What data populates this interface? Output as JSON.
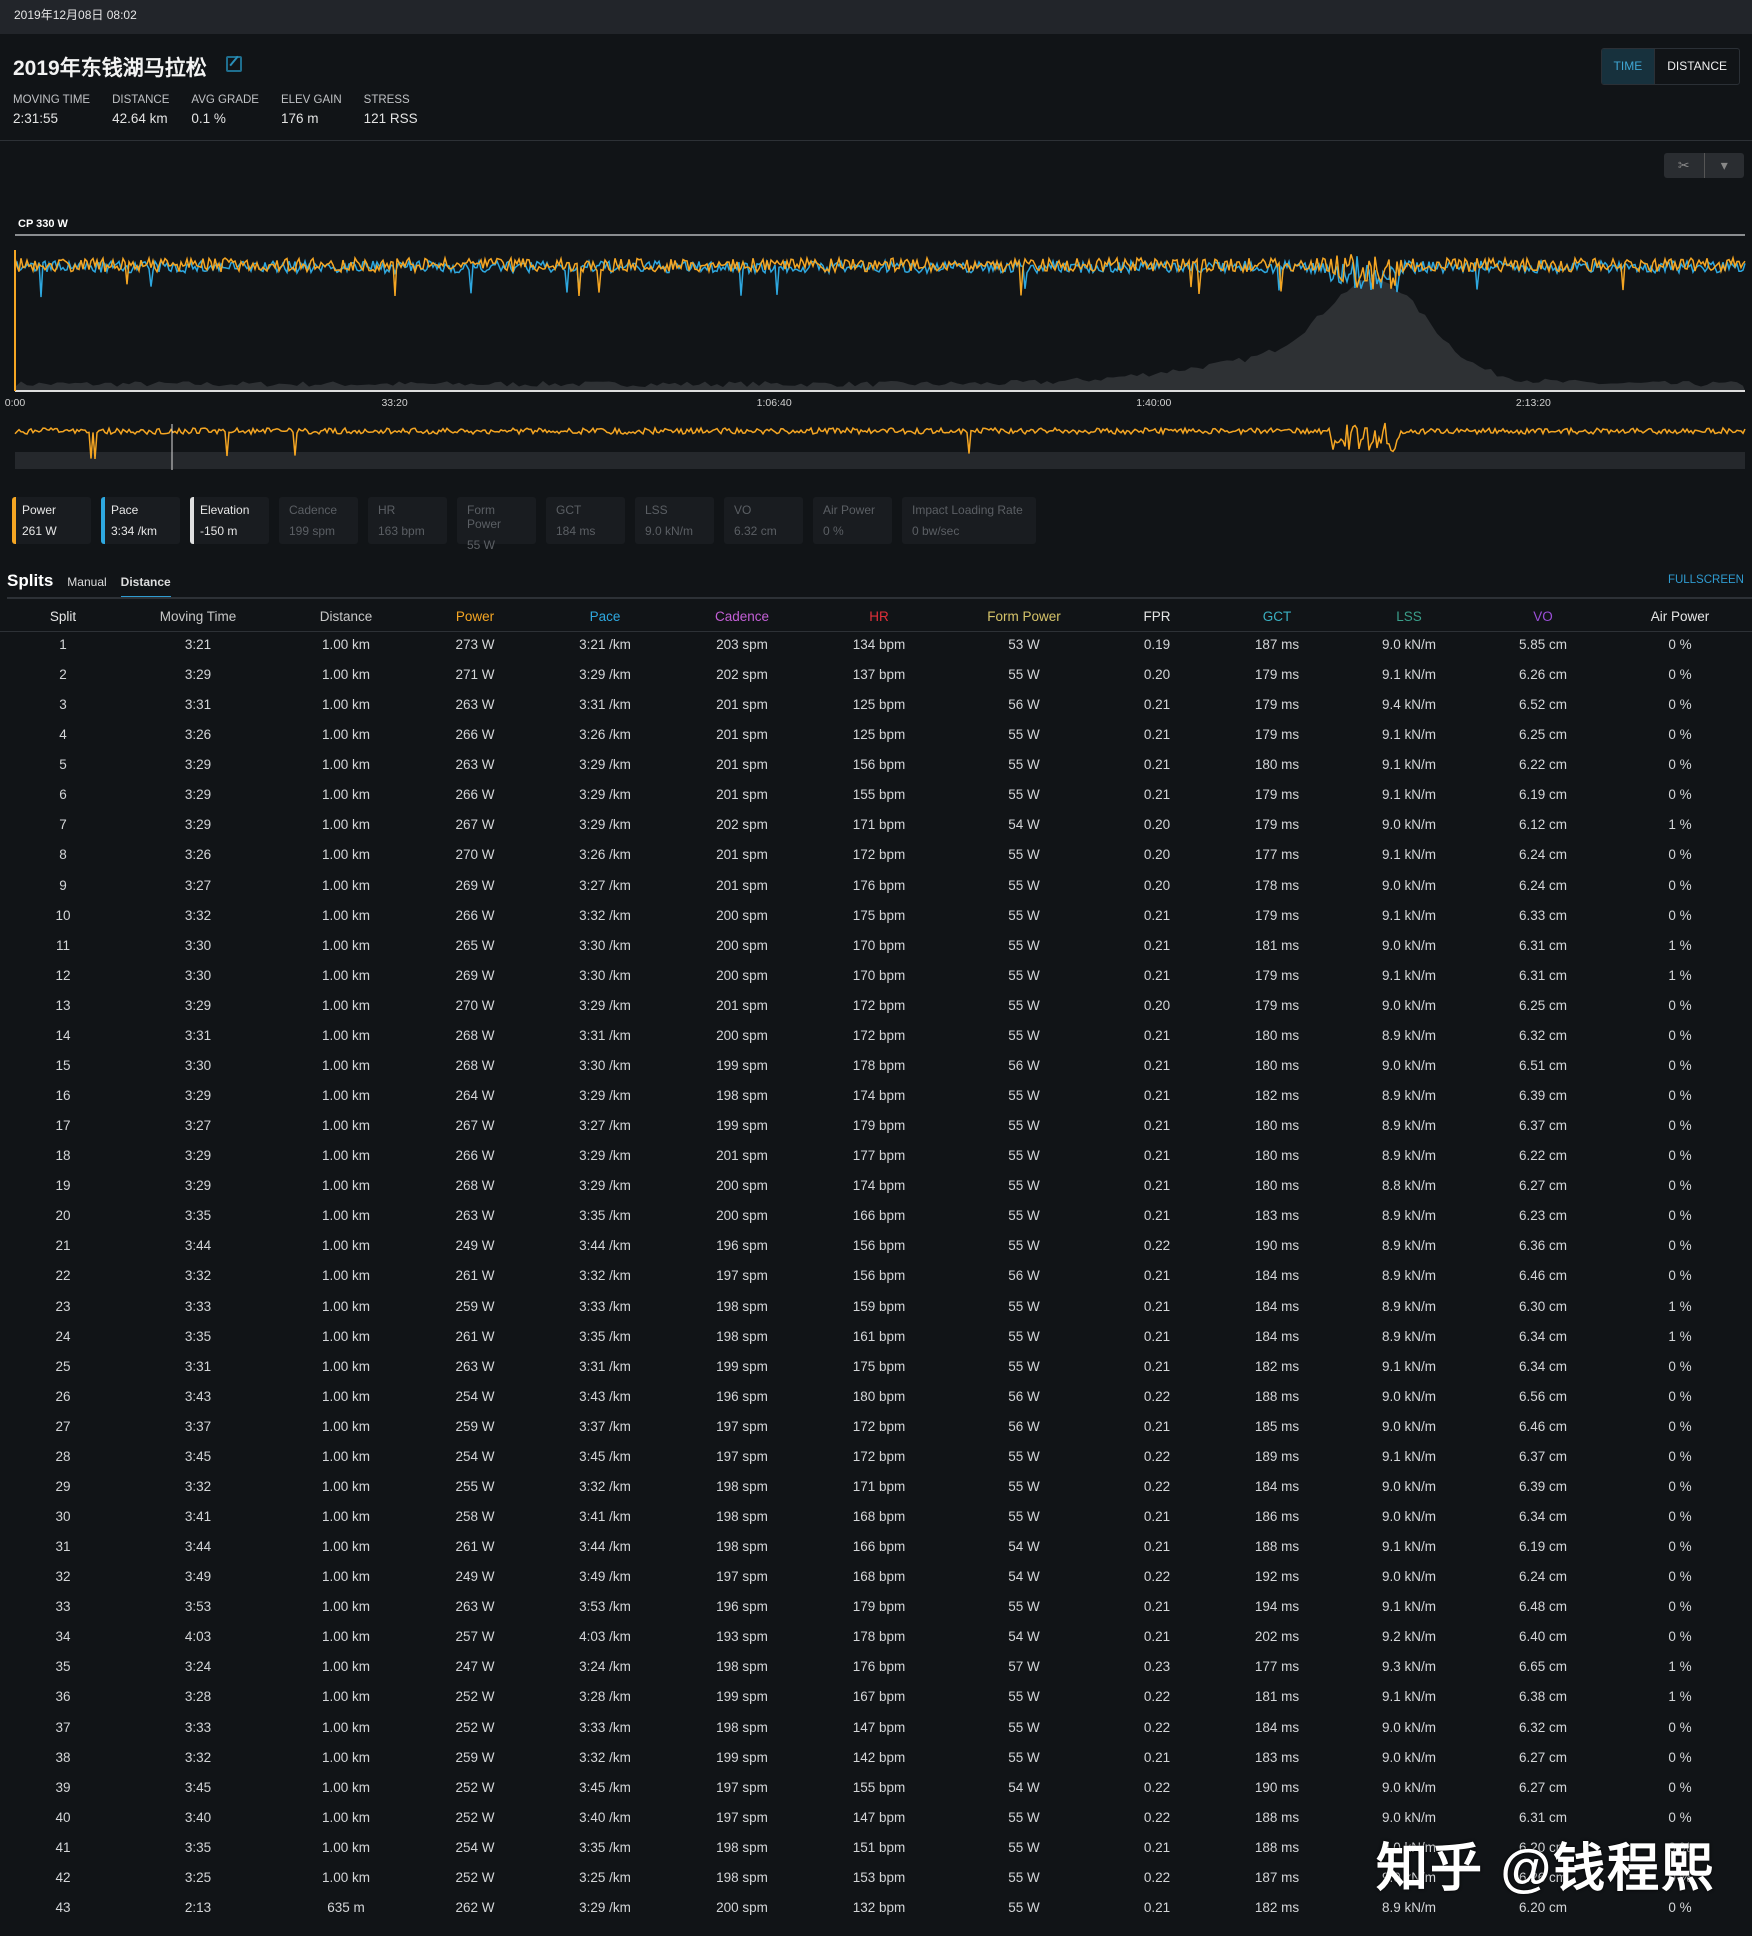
{
  "topbar": {
    "datetime": "2019年12月08日 08:02"
  },
  "header": {
    "title": "2019年东钱湖马拉松",
    "edit_icon": "external-edit-icon",
    "stats": [
      {
        "label": "MOVING TIME",
        "value": "2:31:55"
      },
      {
        "label": "DISTANCE",
        "value": "42.64 km"
      },
      {
        "label": "AVG GRADE",
        "value": "0.1 %"
      },
      {
        "label": "ELEV GAIN",
        "value": "176 m"
      },
      {
        "label": "STRESS",
        "value": "121 RSS"
      }
    ],
    "toggle": {
      "time": "TIME",
      "distance": "DISTANCE",
      "selected": "TIME"
    }
  },
  "chart": {
    "cp_label": "CP 330 W",
    "ticks": [
      "0:00",
      "33:20",
      "1:06:40",
      "1:40:00",
      "2:13:20"
    ],
    "colors": {
      "power": "#f5a623",
      "pace": "#2ea8e0",
      "elevation": "#3a3d41"
    },
    "tools": {
      "scissors_icon": "scissors-icon",
      "dropdown_icon": "caret-down-icon"
    }
  },
  "metrics": [
    {
      "name": "Power",
      "value": "261 W",
      "active": true,
      "color": "#f5a623"
    },
    {
      "name": "Pace",
      "value": "3:34 /km",
      "active": true,
      "color": "#2ea8e0"
    },
    {
      "name": "Elevation",
      "value": "-150 m",
      "active": true,
      "color": "#e0e0e0"
    },
    {
      "name": "Cadence",
      "value": "199 spm",
      "active": false
    },
    {
      "name": "HR",
      "value": "163 bpm",
      "active": false
    },
    {
      "name": "Form Power",
      "value": "55 W",
      "active": false
    },
    {
      "name": "GCT",
      "value": "184 ms",
      "active": false
    },
    {
      "name": "LSS",
      "value": "9.0 kN/m",
      "active": false
    },
    {
      "name": "VO",
      "value": "6.32 cm",
      "active": false
    },
    {
      "name": "Air Power",
      "value": "0 %",
      "active": false
    },
    {
      "name": "Impact Loading Rate",
      "value": "0 bw/sec",
      "active": false
    }
  ],
  "splits": {
    "title": "Splits",
    "tabs": [
      "Manual",
      "Distance"
    ],
    "active_tab": "Distance",
    "fullscreen": "FULLSCREEN",
    "columns": [
      {
        "label": "Split",
        "color": "#e6e6e6"
      },
      {
        "label": "Moving Time",
        "color": "#c8c8c8"
      },
      {
        "label": "Distance",
        "color": "#c8c8c8"
      },
      {
        "label": "Power",
        "color": "#f5a623"
      },
      {
        "label": "Pace",
        "color": "#2ea8e0"
      },
      {
        "label": "Cadence",
        "color": "#c35fd6"
      },
      {
        "label": "HR",
        "color": "#e0303a"
      },
      {
        "label": "Form Power",
        "color": "#d6c46a"
      },
      {
        "label": "FPR",
        "color": "#e6e6e6"
      },
      {
        "label": "GCT",
        "color": "#3ab0c2"
      },
      {
        "label": "LSS",
        "color": "#3a9f8a"
      },
      {
        "label": "VO",
        "color": "#9b4fd8"
      },
      {
        "label": "Air Power",
        "color": "#e6e6e6"
      }
    ],
    "rows": [
      [
        "1",
        "3:21",
        "1.00 km",
        "273 W",
        "3:21 /km",
        "203 spm",
        "134 bpm",
        "53 W",
        "0.19",
        "187 ms",
        "9.0 kN/m",
        "5.85 cm",
        "0 %"
      ],
      [
        "2",
        "3:29",
        "1.00 km",
        "271 W",
        "3:29 /km",
        "202 spm",
        "137 bpm",
        "55 W",
        "0.20",
        "179 ms",
        "9.1 kN/m",
        "6.26 cm",
        "0 %"
      ],
      [
        "3",
        "3:31",
        "1.00 km",
        "263 W",
        "3:31 /km",
        "201 spm",
        "125 bpm",
        "56 W",
        "0.21",
        "179 ms",
        "9.4 kN/m",
        "6.52 cm",
        "0 %"
      ],
      [
        "4",
        "3:26",
        "1.00 km",
        "266 W",
        "3:26 /km",
        "201 spm",
        "125 bpm",
        "55 W",
        "0.21",
        "179 ms",
        "9.1 kN/m",
        "6.25 cm",
        "0 %"
      ],
      [
        "5",
        "3:29",
        "1.00 km",
        "263 W",
        "3:29 /km",
        "201 spm",
        "156 bpm",
        "55 W",
        "0.21",
        "180 ms",
        "9.1 kN/m",
        "6.22 cm",
        "0 %"
      ],
      [
        "6",
        "3:29",
        "1.00 km",
        "266 W",
        "3:29 /km",
        "201 spm",
        "155 bpm",
        "55 W",
        "0.21",
        "179 ms",
        "9.1 kN/m",
        "6.19 cm",
        "0 %"
      ],
      [
        "7",
        "3:29",
        "1.00 km",
        "267 W",
        "3:29 /km",
        "202 spm",
        "171 bpm",
        "54 W",
        "0.20",
        "179 ms",
        "9.0 kN/m",
        "6.12 cm",
        "1 %"
      ],
      [
        "8",
        "3:26",
        "1.00 km",
        "270 W",
        "3:26 /km",
        "201 spm",
        "172 bpm",
        "55 W",
        "0.20",
        "177 ms",
        "9.1 kN/m",
        "6.24 cm",
        "0 %"
      ],
      [
        "9",
        "3:27",
        "1.00 km",
        "269 W",
        "3:27 /km",
        "201 spm",
        "176 bpm",
        "55 W",
        "0.20",
        "178 ms",
        "9.0 kN/m",
        "6.24 cm",
        "0 %"
      ],
      [
        "10",
        "3:32",
        "1.00 km",
        "266 W",
        "3:32 /km",
        "200 spm",
        "175 bpm",
        "55 W",
        "0.21",
        "179 ms",
        "9.1 kN/m",
        "6.33 cm",
        "0 %"
      ],
      [
        "11",
        "3:30",
        "1.00 km",
        "265 W",
        "3:30 /km",
        "200 spm",
        "170 bpm",
        "55 W",
        "0.21",
        "181 ms",
        "9.0 kN/m",
        "6.31 cm",
        "1 %"
      ],
      [
        "12",
        "3:30",
        "1.00 km",
        "269 W",
        "3:30 /km",
        "200 spm",
        "170 bpm",
        "55 W",
        "0.21",
        "179 ms",
        "9.1 kN/m",
        "6.31 cm",
        "1 %"
      ],
      [
        "13",
        "3:29",
        "1.00 km",
        "270 W",
        "3:29 /km",
        "201 spm",
        "172 bpm",
        "55 W",
        "0.20",
        "179 ms",
        "9.0 kN/m",
        "6.25 cm",
        "0 %"
      ],
      [
        "14",
        "3:31",
        "1.00 km",
        "268 W",
        "3:31 /km",
        "200 spm",
        "172 bpm",
        "55 W",
        "0.21",
        "180 ms",
        "8.9 kN/m",
        "6.32 cm",
        "0 %"
      ],
      [
        "15",
        "3:30",
        "1.00 km",
        "268 W",
        "3:30 /km",
        "199 spm",
        "178 bpm",
        "56 W",
        "0.21",
        "180 ms",
        "9.0 kN/m",
        "6.51 cm",
        "0 %"
      ],
      [
        "16",
        "3:29",
        "1.00 km",
        "264 W",
        "3:29 /km",
        "198 spm",
        "174 bpm",
        "55 W",
        "0.21",
        "182 ms",
        "8.9 kN/m",
        "6.39 cm",
        "0 %"
      ],
      [
        "17",
        "3:27",
        "1.00 km",
        "267 W",
        "3:27 /km",
        "199 spm",
        "179 bpm",
        "55 W",
        "0.21",
        "180 ms",
        "8.9 kN/m",
        "6.37 cm",
        "0 %"
      ],
      [
        "18",
        "3:29",
        "1.00 km",
        "266 W",
        "3:29 /km",
        "201 spm",
        "177 bpm",
        "55 W",
        "0.21",
        "180 ms",
        "8.9 kN/m",
        "6.22 cm",
        "0 %"
      ],
      [
        "19",
        "3:29",
        "1.00 km",
        "268 W",
        "3:29 /km",
        "200 spm",
        "174 bpm",
        "55 W",
        "0.21",
        "180 ms",
        "8.8 kN/m",
        "6.27 cm",
        "0 %"
      ],
      [
        "20",
        "3:35",
        "1.00 km",
        "263 W",
        "3:35 /km",
        "200 spm",
        "166 bpm",
        "55 W",
        "0.21",
        "183 ms",
        "8.9 kN/m",
        "6.23 cm",
        "0 %"
      ],
      [
        "21",
        "3:44",
        "1.00 km",
        "249 W",
        "3:44 /km",
        "196 spm",
        "156 bpm",
        "55 W",
        "0.22",
        "190 ms",
        "8.9 kN/m",
        "6.36 cm",
        "0 %"
      ],
      [
        "22",
        "3:32",
        "1.00 km",
        "261 W",
        "3:32 /km",
        "197 spm",
        "156 bpm",
        "56 W",
        "0.21",
        "184 ms",
        "8.9 kN/m",
        "6.46 cm",
        "0 %"
      ],
      [
        "23",
        "3:33",
        "1.00 km",
        "259 W",
        "3:33 /km",
        "198 spm",
        "159 bpm",
        "55 W",
        "0.21",
        "184 ms",
        "8.9 kN/m",
        "6.30 cm",
        "1 %"
      ],
      [
        "24",
        "3:35",
        "1.00 km",
        "261 W",
        "3:35 /km",
        "198 spm",
        "161 bpm",
        "55 W",
        "0.21",
        "184 ms",
        "8.9 kN/m",
        "6.34 cm",
        "1 %"
      ],
      [
        "25",
        "3:31",
        "1.00 km",
        "263 W",
        "3:31 /km",
        "199 spm",
        "175 bpm",
        "55 W",
        "0.21",
        "182 ms",
        "9.1 kN/m",
        "6.34 cm",
        "0 %"
      ],
      [
        "26",
        "3:43",
        "1.00 km",
        "254 W",
        "3:43 /km",
        "196 spm",
        "180 bpm",
        "56 W",
        "0.22",
        "188 ms",
        "9.0 kN/m",
        "6.56 cm",
        "0 %"
      ],
      [
        "27",
        "3:37",
        "1.00 km",
        "259 W",
        "3:37 /km",
        "197 spm",
        "172 bpm",
        "56 W",
        "0.21",
        "185 ms",
        "9.0 kN/m",
        "6.46 cm",
        "0 %"
      ],
      [
        "28",
        "3:45",
        "1.00 km",
        "254 W",
        "3:45 /km",
        "197 spm",
        "172 bpm",
        "55 W",
        "0.22",
        "189 ms",
        "9.1 kN/m",
        "6.37 cm",
        "0 %"
      ],
      [
        "29",
        "3:32",
        "1.00 km",
        "255 W",
        "3:32 /km",
        "198 spm",
        "171 bpm",
        "55 W",
        "0.22",
        "184 ms",
        "9.0 kN/m",
        "6.39 cm",
        "0 %"
      ],
      [
        "30",
        "3:41",
        "1.00 km",
        "258 W",
        "3:41 /km",
        "198 spm",
        "168 bpm",
        "55 W",
        "0.21",
        "186 ms",
        "9.0 kN/m",
        "6.34 cm",
        "0 %"
      ],
      [
        "31",
        "3:44",
        "1.00 km",
        "261 W",
        "3:44 /km",
        "198 spm",
        "166 bpm",
        "54 W",
        "0.21",
        "188 ms",
        "9.1 kN/m",
        "6.19 cm",
        "0 %"
      ],
      [
        "32",
        "3:49",
        "1.00 km",
        "249 W",
        "3:49 /km",
        "197 spm",
        "168 bpm",
        "54 W",
        "0.22",
        "192 ms",
        "9.0 kN/m",
        "6.24 cm",
        "0 %"
      ],
      [
        "33",
        "3:53",
        "1.00 km",
        "263 W",
        "3:53 /km",
        "196 spm",
        "179 bpm",
        "55 W",
        "0.21",
        "194 ms",
        "9.1 kN/m",
        "6.48 cm",
        "0 %"
      ],
      [
        "34",
        "4:03",
        "1.00 km",
        "257 W",
        "4:03 /km",
        "193 spm",
        "178 bpm",
        "54 W",
        "0.21",
        "202 ms",
        "9.2 kN/m",
        "6.40 cm",
        "0 %"
      ],
      [
        "35",
        "3:24",
        "1.00 km",
        "247 W",
        "3:24 /km",
        "198 spm",
        "176 bpm",
        "57 W",
        "0.23",
        "177 ms",
        "9.3 kN/m",
        "6.65 cm",
        "1 %"
      ],
      [
        "36",
        "3:28",
        "1.00 km",
        "252 W",
        "3:28 /km",
        "199 spm",
        "167 bpm",
        "55 W",
        "0.22",
        "181 ms",
        "9.1 kN/m",
        "6.38 cm",
        "1 %"
      ],
      [
        "37",
        "3:33",
        "1.00 km",
        "252 W",
        "3:33 /km",
        "198 spm",
        "147 bpm",
        "55 W",
        "0.22",
        "184 ms",
        "9.0 kN/m",
        "6.32 cm",
        "0 %"
      ],
      [
        "38",
        "3:32",
        "1.00 km",
        "259 W",
        "3:32 /km",
        "199 spm",
        "142 bpm",
        "55 W",
        "0.21",
        "183 ms",
        "9.0 kN/m",
        "6.27 cm",
        "0 %"
      ],
      [
        "39",
        "3:45",
        "1.00 km",
        "252 W",
        "3:45 /km",
        "197 spm",
        "155 bpm",
        "54 W",
        "0.22",
        "190 ms",
        "9.0 kN/m",
        "6.27 cm",
        "0 %"
      ],
      [
        "40",
        "3:40",
        "1.00 km",
        "252 W",
        "3:40 /km",
        "197 spm",
        "147 bpm",
        "55 W",
        "0.22",
        "188 ms",
        "9.0 kN/m",
        "6.31 cm",
        "0 %"
      ],
      [
        "41",
        "3:35",
        "1.00 km",
        "254 W",
        "3:35 /km",
        "198 spm",
        "151 bpm",
        "55 W",
        "0.21",
        "188 ms",
        "9.0 kN/m",
        "6.20 cm",
        "0 %"
      ],
      [
        "42",
        "3:25",
        "1.00 km",
        "252 W",
        "3:25 /km",
        "198 spm",
        "153 bpm",
        "55 W",
        "0.22",
        "187 ms",
        "9.0 kN/m",
        "6.26 cm",
        "0 %"
      ],
      [
        "43",
        "2:13",
        "635 m",
        "262 W",
        "3:29 /km",
        "200 spm",
        "132 bpm",
        "55 W",
        "0.21",
        "182 ms",
        "8.9 kN/m",
        "6.20 cm",
        "0 %"
      ]
    ]
  },
  "watermark": "知乎 @钱程熙"
}
